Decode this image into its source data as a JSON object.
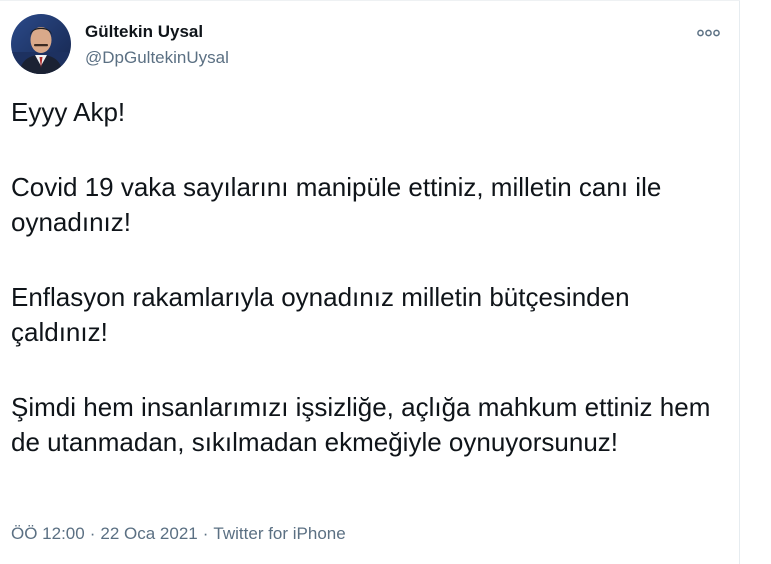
{
  "author": {
    "display_name": "Gültekin Uysal",
    "handle": "@DpGultekinUysal",
    "avatar_icon": "profile-photo-avatar"
  },
  "menu": {
    "icon": "more-options-icon"
  },
  "tweet": {
    "paragraphs": [
      "Eyyy Akp!",
      "Covid 19 vaka sayılarını manipüle ettiniz, milletin canı ile oynadınız!",
      "Enflasyon rakamlarıyla oynadınız milletin bütçesinden çaldınız!",
      "Şimdi hem insanlarımızı işsizliğe, açlığa mahkum ettiniz hem de utanmadan, sıkılmadan ekmeğiyle oynuyorsunuz!"
    ]
  },
  "meta": {
    "time": "ÖÖ 12:00",
    "separator": "·",
    "date": "22 Oca 2021",
    "source": "Twitter for iPhone"
  },
  "colors": {
    "text": "#0f1419",
    "secondary": "#5b7083",
    "border": "#e6ecf0"
  }
}
